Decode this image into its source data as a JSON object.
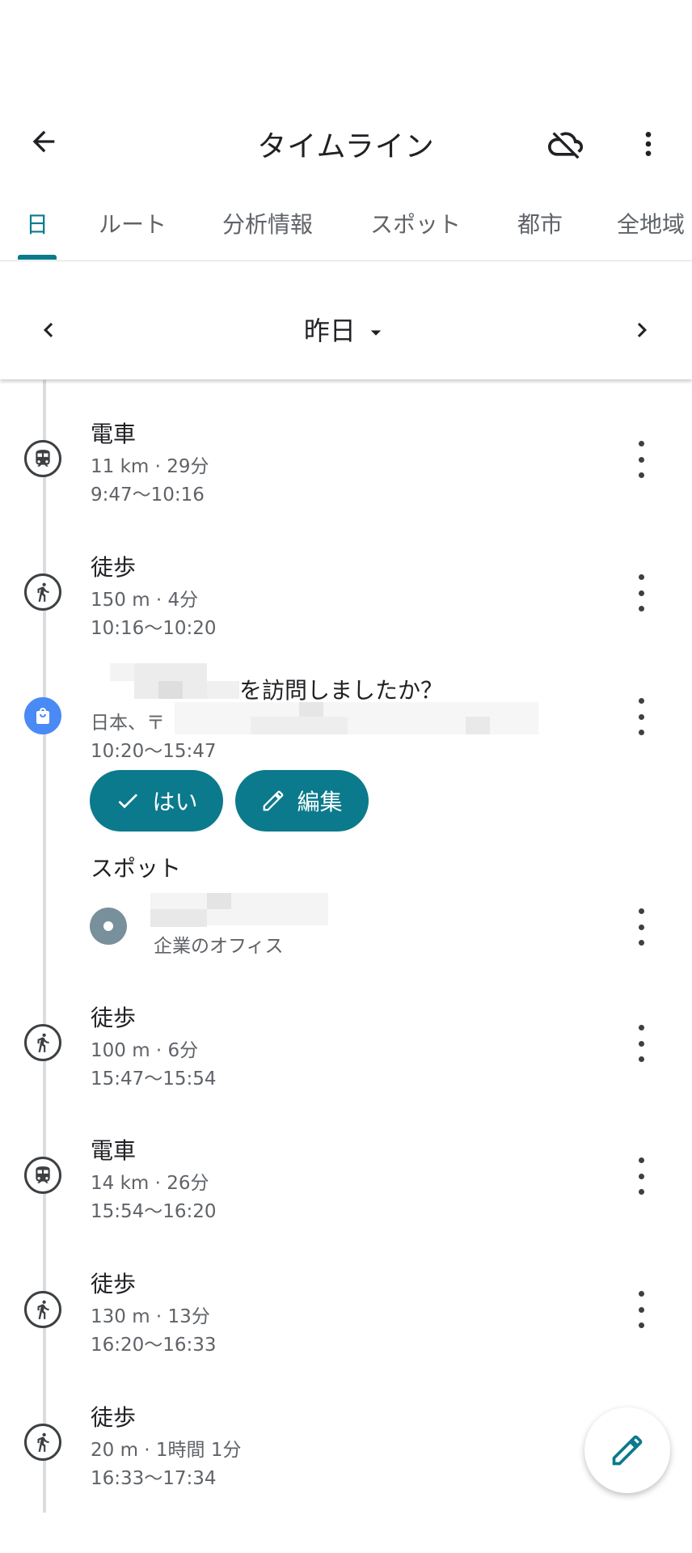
{
  "app_bar": {
    "title": "タイムライン",
    "back_icon": "arrow-back-icon",
    "cloud_icon": "cloud-off-icon",
    "more_icon": "more-vert-icon"
  },
  "tabs": [
    {
      "label": "日",
      "active": true
    },
    {
      "label": "ルート",
      "active": false
    },
    {
      "label": "分析情報",
      "active": false
    },
    {
      "label": "スポット",
      "active": false
    },
    {
      "label": "都市",
      "active": false
    },
    {
      "label": "全地域",
      "active": false
    }
  ],
  "date_bar": {
    "label": "昨日",
    "prev_icon": "chevron-left-icon",
    "next_icon": "chevron-right-icon",
    "dropdown_icon": "arrow-drop-down-icon"
  },
  "timeline": {
    "train1": {
      "title": "電車",
      "detail": "11 km · 29分",
      "time": "9:47〜10:16",
      "icon": "train-icon"
    },
    "walk1": {
      "title": "徒歩",
      "detail": "150 m · 4分",
      "time": "10:16〜10:20",
      "icon": "walk-icon"
    },
    "visit": {
      "question": "を訪問しましたか？",
      "address": "日本、〒",
      "time": "10:20〜15:47",
      "icon": "shopping-bag-icon",
      "yes_label": "はい",
      "edit_label": "編集",
      "spots_heading": "スポット",
      "spot_category": "企業のオフィス"
    },
    "walk2": {
      "title": "徒歩",
      "detail": "100 m · 6分",
      "time": "15:47〜15:54",
      "icon": "walk-icon"
    },
    "train2": {
      "title": "電車",
      "detail": "14 km · 26分",
      "time": "15:54〜16:20",
      "icon": "train-icon"
    },
    "walk3": {
      "title": "徒歩",
      "detail": "130 m · 13分",
      "time": "16:20〜16:33",
      "icon": "walk-icon"
    },
    "walk4": {
      "title": "徒歩",
      "detail": "20 m · 1時間 1分",
      "time": "16:33〜17:34",
      "icon": "walk-icon"
    }
  },
  "fab": {
    "icon": "edit-pencil-icon"
  },
  "colors": {
    "accent": "#0b7a8c",
    "visit_icon": "#4a8af4",
    "spot_dot": "#78909c"
  }
}
